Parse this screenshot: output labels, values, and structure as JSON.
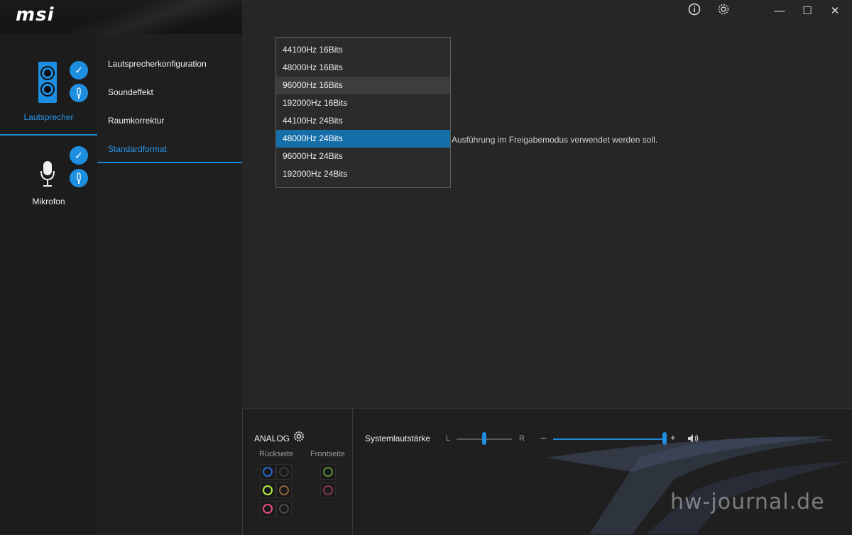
{
  "brand": {
    "logo": "msi"
  },
  "titlebar": {
    "info_icon": "info-icon",
    "settings_icon": "gear-icon",
    "minimize": "—",
    "maximize": "☐",
    "close": "✕"
  },
  "devices": {
    "speaker": {
      "label": "Lautsprecher",
      "check": "✓",
      "jack": "🎙"
    },
    "mic": {
      "label": "Mikrofon",
      "check": "✓",
      "jack": "🎙"
    }
  },
  "menu": {
    "items": [
      {
        "label": "Lautsprecherkonfiguration"
      },
      {
        "label": "Soundeffekt"
      },
      {
        "label": "Raumkorrektur"
      },
      {
        "label": "Standardformat"
      }
    ],
    "active_index": 3
  },
  "main": {
    "description": "Ausführung im Freigabemodus verwendet werden soll."
  },
  "dropdown": {
    "options": [
      {
        "label": "44100Hz 16Bits"
      },
      {
        "label": "48000Hz 16Bits"
      },
      {
        "label": "96000Hz 16Bits"
      },
      {
        "label": "192000Hz 16Bits"
      },
      {
        "label": "44100Hz 24Bits"
      },
      {
        "label": "48000Hz 24Bits"
      },
      {
        "label": "96000Hz 24Bits"
      },
      {
        "label": "192000Hz 24Bits"
      }
    ],
    "hover_index": 2,
    "selected_index": 5
  },
  "bottom": {
    "analog_label": "ANALOG",
    "rear_label": "Rückseite",
    "front_label": "Frontseite",
    "system_volume_label": "Systemlautstärke",
    "left_label": "L",
    "right_label": "R",
    "minus": "–",
    "plus": "+",
    "balance": 0.5,
    "volume": 0.98,
    "jack_colors": {
      "rear": [
        "#2a6bd0",
        "#3a3a3a",
        "#b8f040",
        "#8a6238",
        "#e8508a",
        "#4a4a4a"
      ],
      "front": [
        "#5a8a3a",
        "#8a3a4a"
      ]
    }
  },
  "watermark": "hw-journal.de",
  "colors": {
    "accent": "#1e88d8",
    "selected_bg": "#146ea8"
  }
}
